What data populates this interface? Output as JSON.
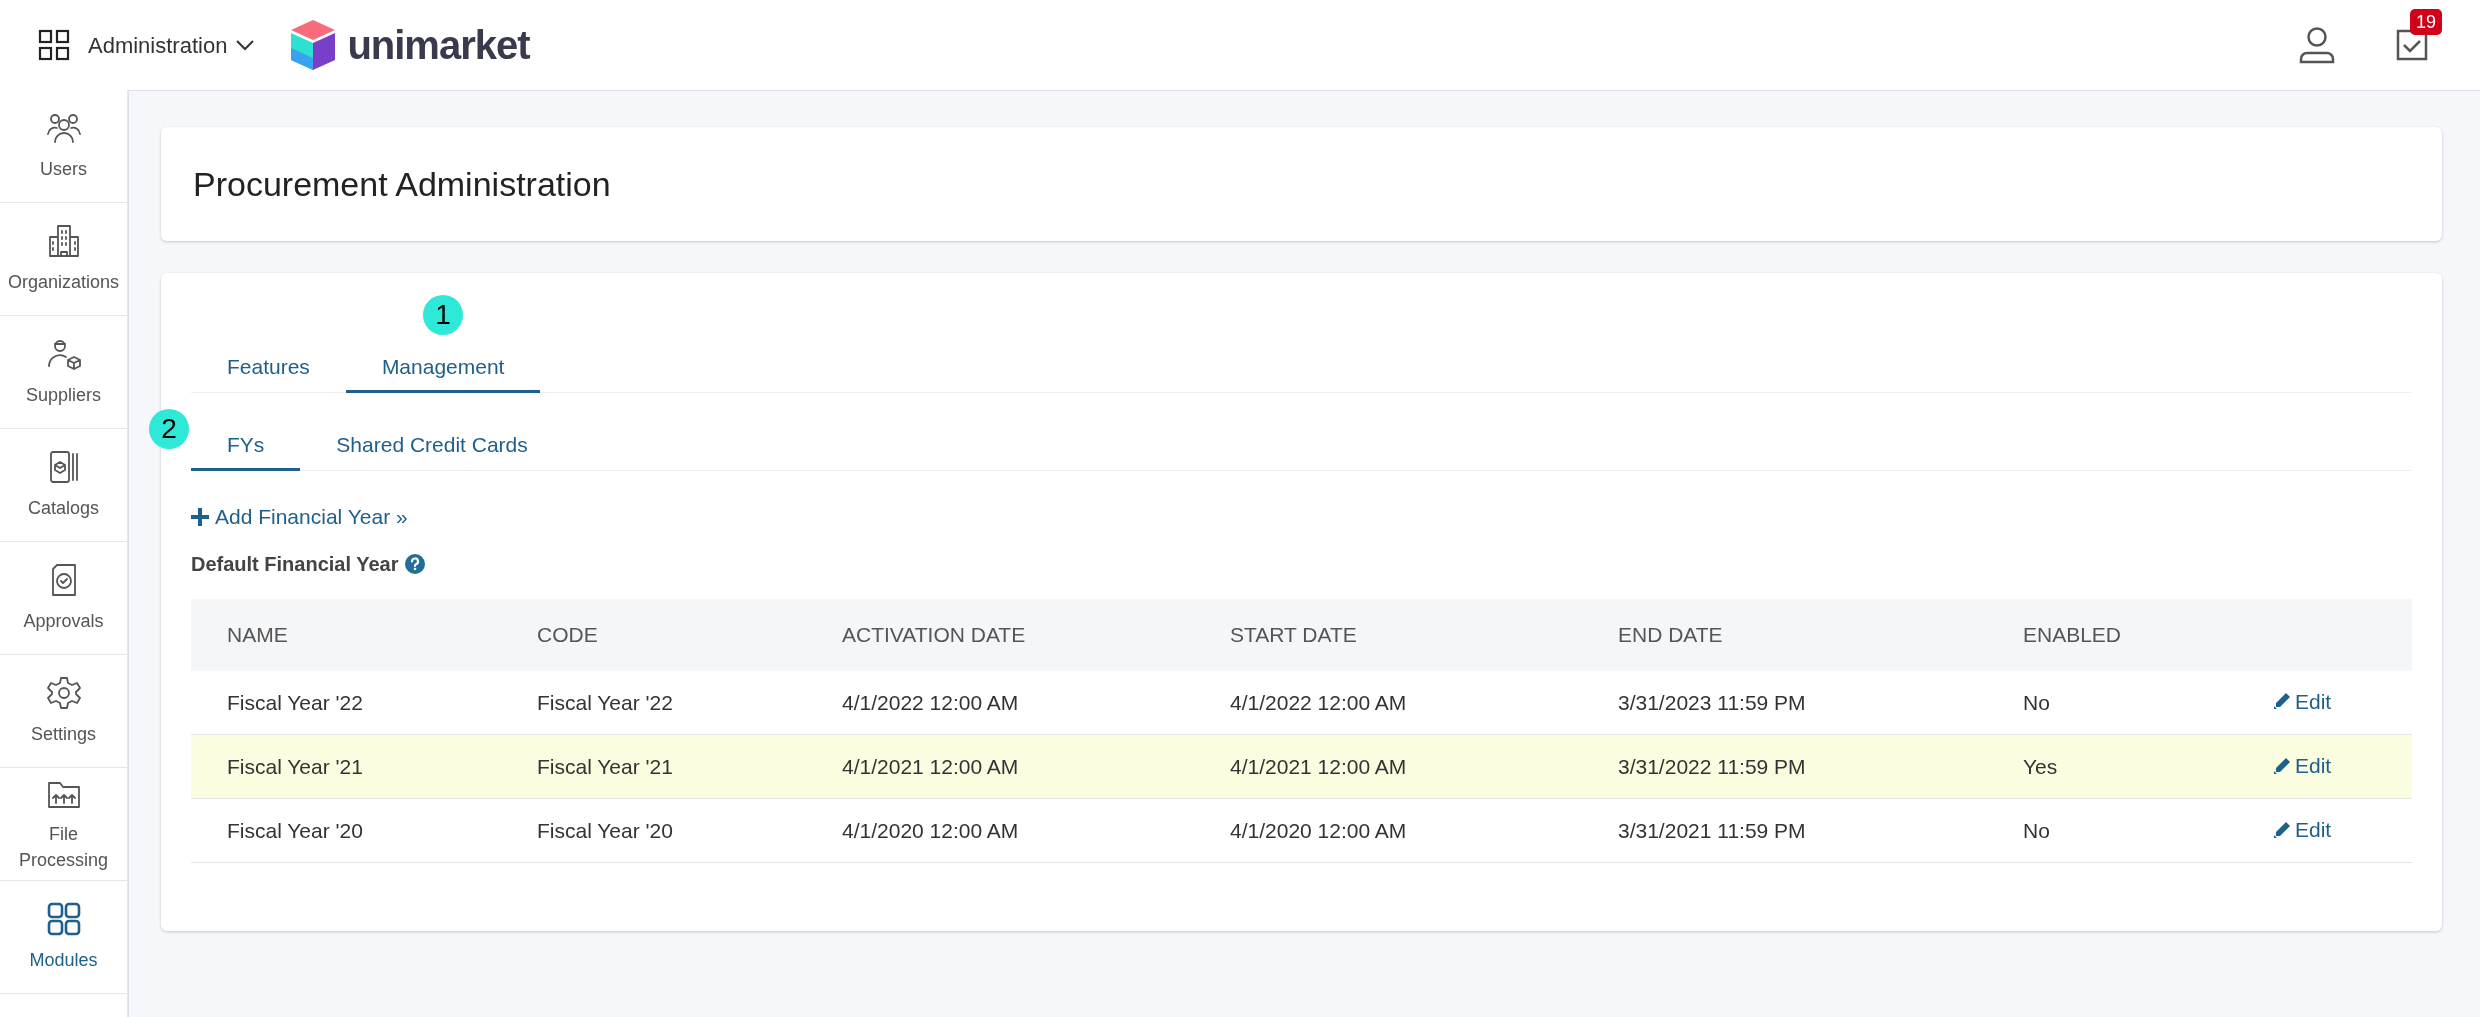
{
  "header": {
    "menu_label": "Administration",
    "logo_text": "unimarket",
    "notification_count": "19"
  },
  "sidebar": {
    "items": [
      {
        "label": "Users",
        "selected": false
      },
      {
        "label": "Organizations",
        "selected": false
      },
      {
        "label": "Suppliers",
        "selected": false
      },
      {
        "label": "Catalogs",
        "selected": false
      },
      {
        "label": "Approvals",
        "selected": false
      },
      {
        "label": "Settings",
        "selected": false
      },
      {
        "label": "File Processing",
        "selected": false
      },
      {
        "label": "Modules",
        "selected": true
      }
    ]
  },
  "page_title": "Procurement Administration",
  "tabs": [
    {
      "label": "Features",
      "selected": false
    },
    {
      "label": "Management",
      "selected": true,
      "marker": "1"
    }
  ],
  "subtabs": [
    {
      "label": "FYs",
      "selected": true,
      "marker": "2"
    },
    {
      "label": "Shared Credit Cards",
      "selected": false
    }
  ],
  "add_link": "Add Financial Year »",
  "section_label": "Default Financial Year",
  "table": {
    "columns": [
      "NAME",
      "CODE",
      "ACTIVATION DATE",
      "START DATE",
      "END DATE",
      "ENABLED"
    ],
    "rows": [
      {
        "cells": [
          "Fiscal Year '22",
          "Fiscal Year '22",
          "4/1/2022 12:00 AM",
          "4/1/2022 12:00 AM",
          "3/31/2023 11:59 PM",
          "No"
        ],
        "action": "Edit",
        "highlighted": false
      },
      {
        "cells": [
          "Fiscal Year '21",
          "Fiscal Year '21",
          "4/1/2021 12:00 AM",
          "4/1/2021 12:00 AM",
          "3/31/2022 11:59 PM",
          "Yes"
        ],
        "action": "Edit",
        "highlighted": true
      },
      {
        "cells": [
          "Fiscal Year '20",
          "Fiscal Year '20",
          "4/1/2020 12:00 AM",
          "4/1/2020 12:00 AM",
          "3/31/2021 11:59 PM",
          "No"
        ],
        "action": "Edit",
        "highlighted": false
      }
    ]
  }
}
